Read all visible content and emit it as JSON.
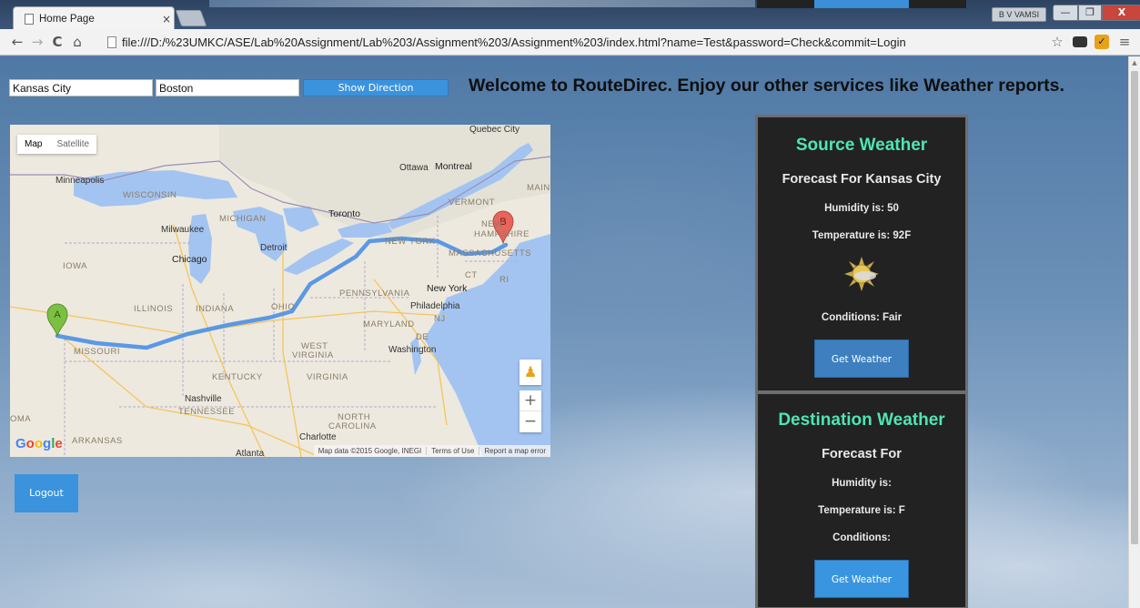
{
  "browser": {
    "tab_title": "Home Page",
    "tab_close": "×",
    "url": "file:///D:/%23UMKC/ASE/Lab%20Assignment/Lab%203/Assignment%203/Assignment%203/index.html?name=Test&password=Check&commit=Login",
    "user_badge": "B V VAMSI",
    "nav": {
      "back": "←",
      "forward": "→",
      "reload": "C",
      "home": "⌂"
    },
    "toolbar_icons": [
      "star-icon",
      "glasses-extension-icon",
      "check-extension-icon",
      "menu-icon"
    ],
    "window_controls": {
      "minimize": "—",
      "maximize": "❐",
      "close": "X"
    }
  },
  "form": {
    "source_value": "Kansas City",
    "destination_value": "Boston",
    "show_direction_label": "Show Direction"
  },
  "welcome_text": "Welcome to RouteDirec. Enjoy our other services like Weather reports.",
  "map": {
    "type_map": "Map",
    "type_satellite": "Satellite",
    "marker_a": "A",
    "marker_b": "B",
    "google_logo": "Google",
    "footer": [
      "Map data ©2015 Google, INEGI",
      "Terms of Use",
      "Report a map error"
    ],
    "zoom_in": "+",
    "zoom_out": "−",
    "labels": {
      "quebec_city": "Quebec City",
      "ottawa": "Ottawa",
      "montreal": "Montreal",
      "minneapolis": "Minneapolis",
      "wisconsin": "WISCONSIN",
      "vermont": "VERMONT",
      "maine": "MAIN",
      "michigan": "MICHIGAN",
      "toronto": "Toronto",
      "milwaukee": "Milwaukee",
      "new_hampshire_1": "NEW",
      "new_hampshire_2": "HAMPSHIRE",
      "detroit": "Detroit",
      "new_york_state": "NEW YORK",
      "massachusetts": "MASSACHUSETTS",
      "iowa": "IOWA",
      "chicago": "Chicago",
      "ct": "CT",
      "ri": "RI",
      "pennsylvania": "PENNSYLVANIA",
      "new_york_city": "New York",
      "illinois": "ILLINOIS",
      "indiana": "INDIANA",
      "ohio": "OHIO",
      "philadelphia": "Philadelphia",
      "nj": "NJ",
      "maryland": "MARYLAND",
      "de": "DE",
      "missouri": "MISSOURI",
      "west_virginia_1": "WEST",
      "west_virginia_2": "VIRGINIA",
      "washington": "Washington",
      "kentucky": "KENTUCKY",
      "virginia": "VIRGINIA",
      "nashville": "Nashville",
      "tennessee": "TENNESSEE",
      "oklahoma": "OMA",
      "north_carolina_1": "NORTH",
      "north_carolina_2": "CAROLINA",
      "charlotte": "Charlotte",
      "arkansas": "ARKANSAS",
      "atlanta": "Atlanta"
    }
  },
  "logout_label": "Logout",
  "source_weather": {
    "title": "Source Weather",
    "forecast": "Forecast For Kansas City",
    "humidity": "Humidity is: 50",
    "temperature": "Temperature is: 92F",
    "icon": "sun-icon",
    "conditions": "Conditions: Fair",
    "button": "Get Weather"
  },
  "destination_weather": {
    "title": "Destination Weather",
    "forecast": "Forecast For",
    "humidity": "Humidity is:",
    "temperature": "Temperature is: F",
    "conditions": "Conditions:",
    "button": "Get Weather"
  },
  "colors": {
    "accent_button": "#3b93dd",
    "panel_bg": "#222222",
    "panel_title": "#4ee6b0",
    "route_line": "#4a8fe6",
    "marker_a": "#7bc043",
    "marker_b": "#e8655b"
  }
}
